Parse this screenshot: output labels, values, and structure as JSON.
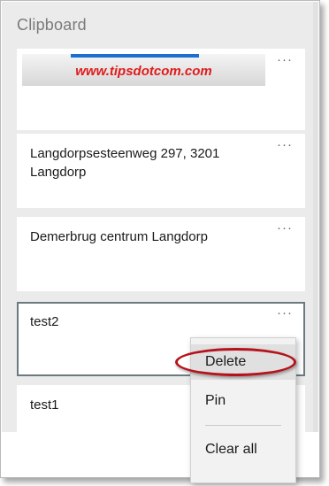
{
  "panel": {
    "title": "Clipboard"
  },
  "items": [
    {
      "kind": "image",
      "banner_text": "www.tipsdotcom.com",
      "more": "···"
    },
    {
      "kind": "text",
      "text": "Langdorpsesteenweg 297, 3201 Langdorp",
      "more": "···"
    },
    {
      "kind": "text",
      "text": "Demerbrug centrum Langdorp",
      "more": "···"
    },
    {
      "kind": "text",
      "text": "test2",
      "more": "···",
      "selected": true
    },
    {
      "kind": "text",
      "text": "test1",
      "more": "···"
    }
  ],
  "context_menu": {
    "delete_label": "Delete",
    "pin_label": "Pin",
    "clear_all_label": "Clear all"
  },
  "colors": {
    "annotation_ring": "#b5121b",
    "banner_text": "#e01b1b",
    "banner_bar": "#1a6fd1"
  }
}
